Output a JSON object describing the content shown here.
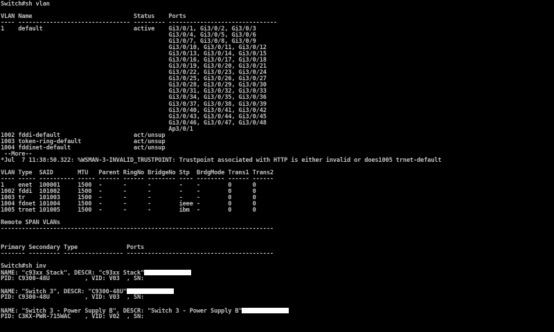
{
  "terminal": {
    "lines": [
      "Switch#sh vlan",
      "",
      "VLAN Name                             Status    Ports",
      "---- -------------------------------- --------- -------------------------------",
      "1    default                          active    Gi3/0/1, Gi3/0/2, Gi3/0/3",
      "                                                Gi3/0/4, Gi3/0/5, Gi3/0/6",
      "                                                Gi3/0/7, Gi3/0/8, Gi3/0/9",
      "                                                Gi3/0/10, Gi3/0/11, Gi3/0/12",
      "                                                Gi3/0/13, Gi3/0/14, Gi3/0/15",
      "                                                Gi3/0/16, Gi3/0/17, Gi3/0/18",
      "                                                Gi3/0/19, Gi3/0/20, Gi3/0/21",
      "                                                Gi3/0/22, Gi3/0/23, Gi3/0/24",
      "                                                Gi3/0/25, Gi3/0/26, Gi3/0/27",
      "                                                Gi3/0/28, Gi3/0/29, Gi3/0/30",
      "                                                Gi3/0/31, Gi3/0/32, Gi3/0/33",
      "                                                Gi3/0/34, Gi3/0/35, Gi3/0/36",
      "                                                Gi3/0/37, Gi3/0/38, Gi3/0/39",
      "                                                Gi3/0/40, Gi3/0/41, Gi3/0/42",
      "                                                Gi3/0/43, Gi3/0/44, Gi3/0/45",
      "                                                Gi3/0/46, Gi3/0/47, Gi3/0/48",
      "                                                Ap3/0/1",
      "1002 fddi-default                     act/unsup",
      "1003 token-ring-default               act/unsup",
      "1004 fddinet-default                  act/unsup",
      " --More--",
      "*Jul  7 11:38:50.322: %WSMAN-3-INVALID_TRUSTPOINT: Trustpoint associated with HTTP is either invalid or does1005 trnet-default",
      "",
      "VLAN Type  SAID       MTU   Parent RingNo BridgeNo Stp  BrdgMode Trans1 Trans2",
      "---- ----- ---------- ----- ------ ------ -------- ---- -------- ------ ------",
      "1    enet  100001     1500  -      -      -        -    -        0      0",
      "1002 fddi  101002     1500  -      -      -        -    -        0      0",
      "1003 tr    101003     1500  -      -      -        -    -        0      0",
      "1004 fdnet 101004     1500  -      -      -        ieee -        0      0",
      "1005 trnet 101005     1500  -      -      -        ibm  -        0      0",
      "",
      "Remote SPAN VLANs",
      "------------------------------------------------------------------------------",
      "",
      "",
      "Primary Secondary Type              Ports",
      "------- --------- ----------------- ------------------------------------------",
      "",
      "Switch#sh inv",
      "NAME: \"c93xx Stack\", DESCR: \"c93xx Stack\"",
      "PID: C9300-48U          , VID: V03  , SN: ",
      "",
      "NAME: \"Switch 3\", DESCR: \"C9300-48U\"",
      "PID: C9300-48U          , VID: V03  , SN: ",
      "",
      "NAME: \"Switch 3 - Power Supply B\", DESCR: \"Switch 3 - Power Supply B\"",
      "PID: C3KX-PWR-715WAC    , VID: V02  , SN: "
    ]
  },
  "redacted_serial_lines": [
    43,
    46,
    49
  ],
  "colors": {
    "background": "#000000",
    "text": "#c0c0c0",
    "redaction": "#ffffff"
  }
}
